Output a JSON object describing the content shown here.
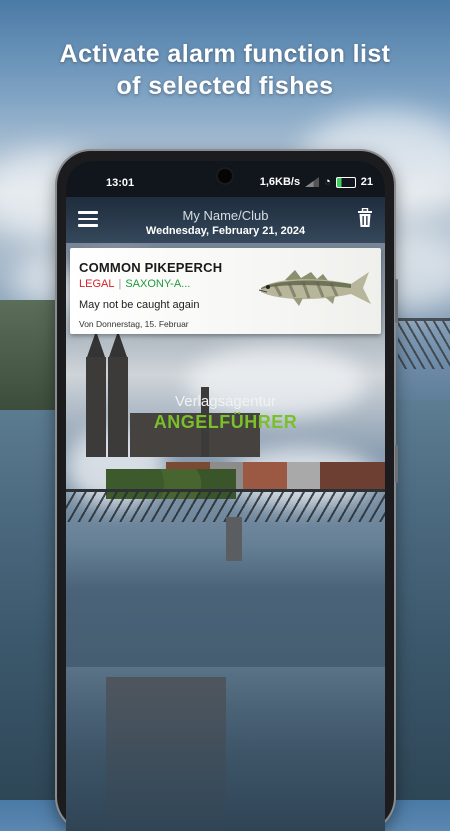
{
  "promo": {
    "headline_line1": "Activate alarm function list",
    "headline_line2": "of selected fishes"
  },
  "status_bar": {
    "time": "13:01",
    "network_speed": "1,6KB/s",
    "battery": "21",
    "icons": [
      "signal-icon",
      "wifi-icon",
      "battery-charging-icon"
    ]
  },
  "app_bar": {
    "title": "My Name/Club",
    "date": "Wednesday, February 21, 2024",
    "left_icon": "menu-icon",
    "right_icon": "trash-icon"
  },
  "fish_card": {
    "name": "COMMON PIKEPERCH",
    "status": "LEGAL",
    "separator": "|",
    "region": "SAXONY-A...",
    "note": "May not be caught again",
    "since": "Von Donnerstag, 15. Februar",
    "image": "pikeperch-fish-icon"
  },
  "brand": {
    "line1": "Verlagsagentur",
    "line2": "ANGELFÜHRER"
  },
  "colors": {
    "legal": "#d2232a",
    "region": "#1f9a3a",
    "brand_green": "#7bbf2a",
    "app_bar": "#1c2a3a"
  }
}
